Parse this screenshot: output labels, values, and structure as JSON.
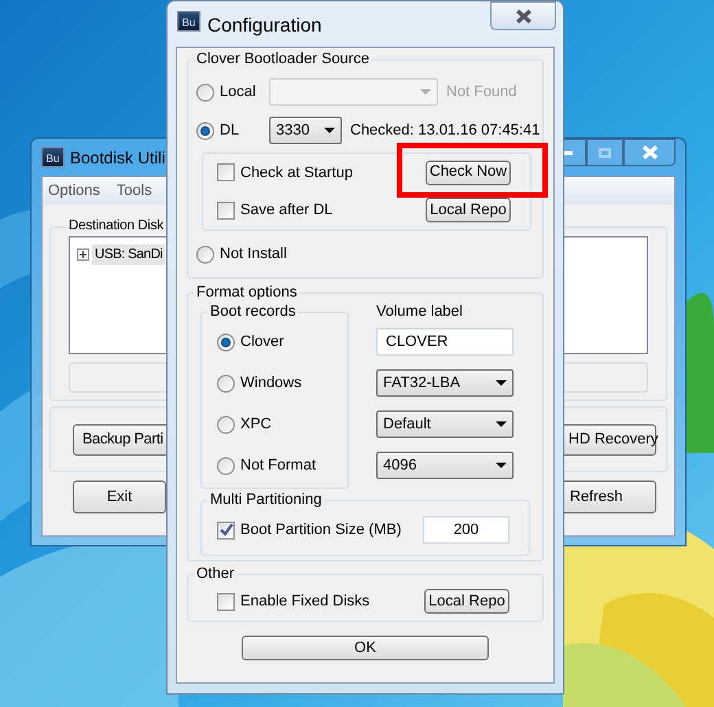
{
  "back_window": {
    "icon_text": "Bu",
    "title": "Bootdisk Utili",
    "menu": [
      "Options",
      "Tools"
    ],
    "destination": {
      "title": "Destination Disk",
      "tree": [
        {
          "label": "USB: SanDi",
          "expanded": false,
          "selected": true
        }
      ]
    },
    "buttons_left": [
      "Backup Parti",
      "Exit"
    ],
    "buttons_right": [
      "HD Recovery",
      "Refresh"
    ]
  },
  "dialog": {
    "icon_text": "Bu",
    "title": "Configuration",
    "source": {
      "title": "Clover Bootloader Source",
      "options": [
        {
          "kind": "local",
          "label": "Local",
          "selected": false,
          "combo": {
            "disabled": true
          },
          "status": "Not Found"
        },
        {
          "kind": "dl",
          "label": "DL",
          "selected": true,
          "combo": {
            "value": "3330",
            "disabled": false
          },
          "status": "Checked: 13.01.16 07:45:41"
        },
        {
          "kind": "none",
          "label": "Not Install",
          "selected": false
        }
      ],
      "dl_rows": [
        {
          "label": "Check at Startup",
          "checked": false,
          "button": {
            "label": "Check Now",
            "highlighted": true
          }
        },
        {
          "label": "Save after DL",
          "checked": false,
          "button": {
            "label": "Local Repo",
            "highlighted": false
          }
        }
      ]
    },
    "format": {
      "title": "Format options",
      "boot_records": {
        "title": "Boot records",
        "options": [
          {
            "label": "Clover",
            "selected": true
          },
          {
            "label": "Windows",
            "selected": false
          },
          {
            "label": "XPC",
            "selected": false
          },
          {
            "label": "Not Format",
            "selected": false
          }
        ]
      },
      "volume_label": {
        "label": "Volume label",
        "value": "CLOVER"
      },
      "selects": [
        {
          "value": "FAT32-LBA"
        },
        {
          "value": "Default"
        },
        {
          "value": "4096"
        }
      ],
      "multi": {
        "title": "Multi Partitioning",
        "label": "Boot Partition Size (MB)",
        "checked": true,
        "value": "200"
      }
    },
    "other": {
      "title": "Other",
      "checkbox": {
        "label": "Enable Fixed Disks",
        "checked": false
      },
      "button": "Local Repo"
    },
    "ok": "OK"
  }
}
